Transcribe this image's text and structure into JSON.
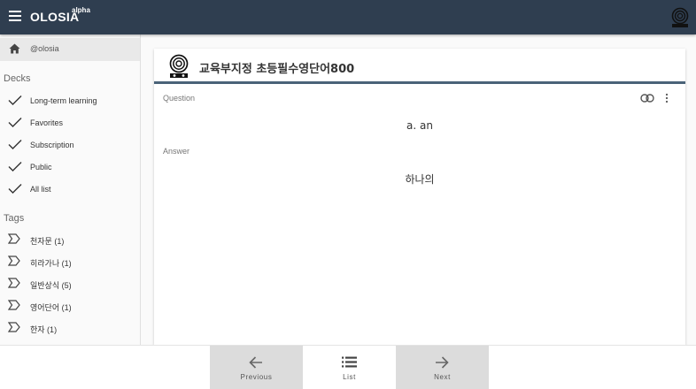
{
  "app": {
    "title": "OLOSIA",
    "badge": "alpha"
  },
  "sidebar": {
    "home_label": "@olosia",
    "decks_heading": "Decks",
    "decks": [
      {
        "label": "Long-term learning",
        "icon": "check-icon"
      },
      {
        "label": "Favorites",
        "icon": "check-icon"
      },
      {
        "label": "Subscription",
        "icon": "check-icon"
      },
      {
        "label": "Public",
        "icon": "check-icon"
      },
      {
        "label": "All list",
        "icon": "check-icon"
      }
    ],
    "tags_heading": "Tags",
    "tags": [
      {
        "label": "천자문 (1)",
        "icon": "tag-icon"
      },
      {
        "label": "히라가나 (1)",
        "icon": "tag-icon"
      },
      {
        "label": "일반상식 (5)",
        "icon": "tag-icon"
      },
      {
        "label": "영어단어 (1)",
        "icon": "tag-icon"
      },
      {
        "label": "한자 (1)",
        "icon": "tag-icon"
      }
    ]
  },
  "card": {
    "title": "교육부지정 초등필수영단어800",
    "question_label": "Question",
    "question": "a. an",
    "answer_label": "Answer",
    "answer": "하나의"
  },
  "bottom_nav": {
    "previous_label": "Previous",
    "list_label": "List",
    "next_label": "Next"
  },
  "colors": {
    "appbar": "#2f3e50",
    "accent": "#4a6378"
  }
}
